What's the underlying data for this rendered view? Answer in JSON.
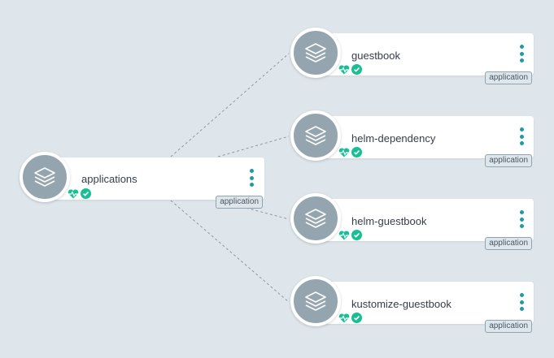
{
  "root": {
    "name": "applications",
    "kind": "application",
    "icon": "layers-icon",
    "health_icon": "heart-health-icon",
    "sync_icon": "check-circle-icon"
  },
  "children": [
    {
      "name": "guestbook",
      "kind": "application",
      "icon": "layers-icon"
    },
    {
      "name": "helm-dependency",
      "kind": "application",
      "icon": "layers-icon"
    },
    {
      "name": "helm-guestbook",
      "kind": "application",
      "icon": "layers-icon"
    },
    {
      "name": "kustomize-guestbook",
      "kind": "application",
      "icon": "layers-icon"
    }
  ],
  "colors": {
    "background": "#dee6eb",
    "node_circle": "#94a5b0",
    "healthy": "#18be94",
    "menu_dots": "#1d9ca7",
    "edge": "#8b98a3"
  }
}
